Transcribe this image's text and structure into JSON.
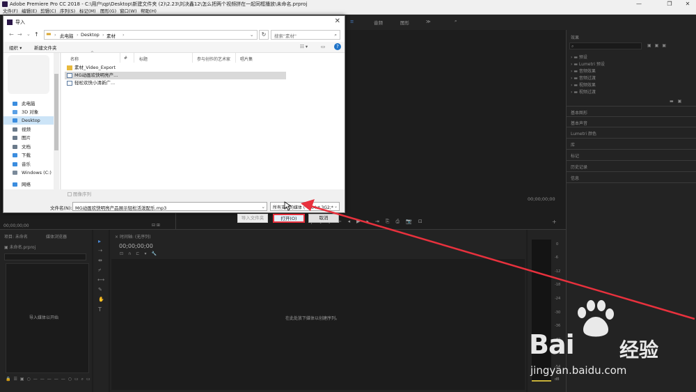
{
  "window": {
    "title": "Adobe Premiere Pro CC 2018 - C:\\用户\\qp\\Desktop\\新建文件夹 (2)\\2.23\\刘决鑫12\\怎么把两个视频拼在一起同框播放\\未命名.prproj",
    "minimize": "—",
    "restore": "❐",
    "close": "✕"
  },
  "menu": [
    "文件(F)",
    "编辑(E)",
    "剪辑(C)",
    "序列(S)",
    "标记(M)",
    "图形(G)",
    "窗口(W)",
    "帮助(H)"
  ],
  "workspace_tabs": [
    "音频",
    "图形",
    "≫"
  ],
  "premiere": {
    "effects_title": "效果",
    "effects_tree": [
      "预设",
      "Lumetri 预设",
      "音频效果",
      "音频过渡",
      "视频效果",
      "视频过渡"
    ],
    "side_panels": [
      "基本图形",
      "基本声音",
      "Lumetri 颜色",
      "库",
      "标记",
      "历史记录",
      "信息"
    ],
    "program_timecode": "00;00;00;00",
    "source_timecode": "00;00;00;00",
    "project_tabs": [
      "项目: 未命名",
      "媒体浏览器"
    ],
    "project_file": "未命名.prproj",
    "import_hint": "导入媒体以开始",
    "timeline_title": "时间轴: (无序列)",
    "timeline_timecode": "00;00;00;00",
    "timeline_hint": "在此处放下媒体以创建序列。",
    "meter_scale": [
      "0",
      "-6",
      "-12",
      "-18",
      "-24",
      "-30",
      "-36",
      "-42",
      "-48",
      "-54",
      "dB"
    ]
  },
  "dialog": {
    "title": "导入",
    "close": "✕",
    "nav": {
      "back": "←",
      "forward": "→",
      "recent": "⌄",
      "up": "↑"
    },
    "breadcrumb": [
      "此电脑",
      "Desktop",
      "素材"
    ],
    "refresh": "↻",
    "search_placeholder": "搜索\"素材\"",
    "search_icon": "⌕",
    "toolbar": {
      "organize": "组织 ▾",
      "new_folder": "新建文件夹",
      "help": "?"
    },
    "sidebar": [
      {
        "label": "此电脑",
        "icon": "pc-icon",
        "color": "#3b8ddf"
      },
      {
        "label": "3D 对象",
        "icon": "cube-icon",
        "color": "#5aa0e6"
      },
      {
        "label": "Desktop",
        "icon": "desktop-icon",
        "color": "#3b8ddf",
        "selected": true
      },
      {
        "label": "视频",
        "icon": "video-icon",
        "color": "#6a7a8a"
      },
      {
        "label": "图片",
        "icon": "picture-icon",
        "color": "#6a7a8a"
      },
      {
        "label": "文档",
        "icon": "document-icon",
        "color": "#6a7a8a"
      },
      {
        "label": "下载",
        "icon": "download-icon",
        "color": "#3b8ddf"
      },
      {
        "label": "音乐",
        "icon": "music-icon",
        "color": "#3b8ddf"
      },
      {
        "label": "Windows (C:)",
        "icon": "drive-icon",
        "color": "#7a8a9a"
      },
      {
        "label": "网络",
        "icon": "network-icon",
        "color": "#3b8ddf"
      }
    ],
    "columns": [
      "名称",
      "#",
      "标题",
      "参与创作的艺术家",
      "唱片集"
    ],
    "files": [
      {
        "name": "素材_Video_Export",
        "icon": "folder-icon"
      },
      {
        "name": "MG动画欢快明亮产...",
        "icon": "audio-file-icon",
        "selected": true
      },
      {
        "name": "轻松欢快小清新广...",
        "icon": "audio-file-icon"
      }
    ],
    "image_sequence": "图像序列",
    "filename_label": "文件名(N):",
    "filename_value": "MG动画欢快明亮产品展示轻松活泼配乐.mp3",
    "filetype_value": "所有支持的媒体 (*.264;*.3G2;*",
    "import_folder_button": "导入文件夹",
    "open_button": "打开(O)",
    "cancel_button": "取消"
  },
  "watermark": {
    "brand": "Bai",
    "brand_cn": "经验",
    "url": "jingyan.baidu.com"
  },
  "colors": {
    "accent_red": "#e8313d",
    "premiere_bg": "#1d1d1d",
    "selection": "#cce4f7"
  }
}
